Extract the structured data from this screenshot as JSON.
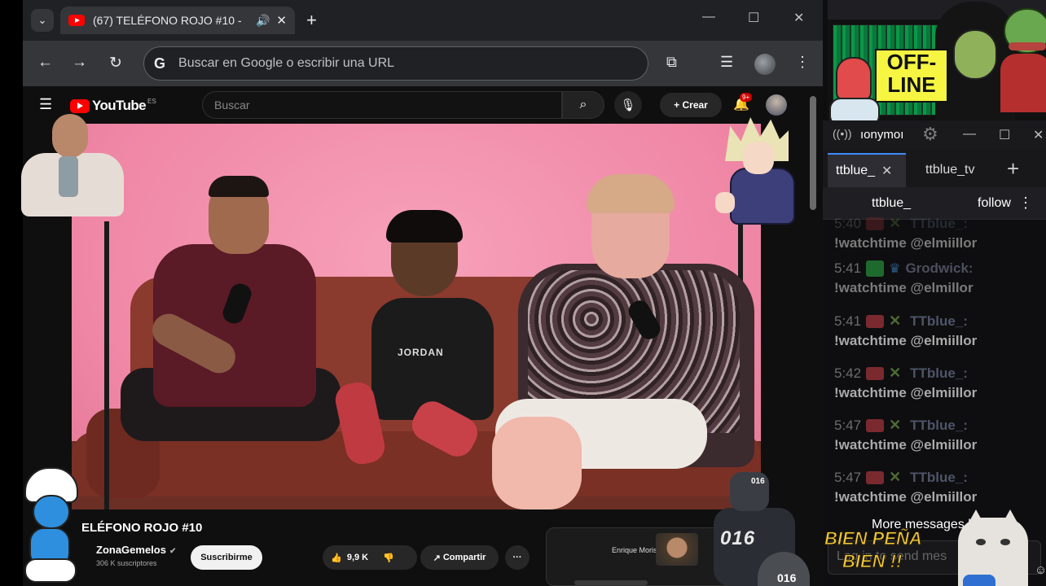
{
  "browser": {
    "tab_title": "(67) TELÉFONO ROJO #10 -",
    "tab_audio_icon": "🔊",
    "tab_close": "✕",
    "new_tab": "+",
    "address_placeholder": "Buscar en Google o escribir una URL",
    "google_g": "G"
  },
  "youtube": {
    "logo_text": "YouTube",
    "logo_region": "ES",
    "search_placeholder": "Buscar",
    "create_label": "Crear",
    "notif_badge": "9+",
    "video_title": "ELÉFONO ROJO #10",
    "channel_name": "ZonaGemelos",
    "subscribers": "306 K suscriptores",
    "subscribe_label": "Suscribirme",
    "likes": "9,9 K",
    "share_label": "Compartir",
    "more_label": "···",
    "ad_name": "Enrique Moris",
    "shirt_text": "JORDAN"
  },
  "stream_overlay": {
    "offline_line1": "OFF-",
    "offline_line2": "LINE",
    "robot_tag": "016",
    "robot_number": "016",
    "robot_shield": "016"
  },
  "chat": {
    "window_title": "ıonymoı",
    "tab_active": "ttblue_",
    "tab_second": "ttblue_tv",
    "channel_user": "ttblue_",
    "follow_label": "follow",
    "messages": [
      {
        "time": "5:40",
        "name": "TTblue_:",
        "text": "!watchtime @elmiillor"
      },
      {
        "time": "5:41",
        "name": "Grodwick:",
        "text": "!watchtime @elmillor"
      },
      {
        "time": "5:41",
        "name": "TTblue_:",
        "text": "!watchtime @elmiillor"
      },
      {
        "time": "5:42",
        "name": "TTblue_:",
        "text": "!watchtime @elmiillor"
      },
      {
        "time": "5:47",
        "name": "TTblue_:",
        "text": "!watchtime @elmiillor"
      },
      {
        "time": "5:47",
        "name": "TTblue_:",
        "text": "!watchtime @elmiillor"
      }
    ],
    "more_messages": "More messages below",
    "input_placeholder": "Log in to send mes",
    "overlay_text_1": "BIEN PEÑA",
    "overlay_text_2": "BIEN !!"
  },
  "colors": {
    "youtube_red": "#ff0000",
    "chat_bg": "#0e0e10",
    "video_wall": "#f08aa8",
    "sofa": "#8b3a2e"
  }
}
